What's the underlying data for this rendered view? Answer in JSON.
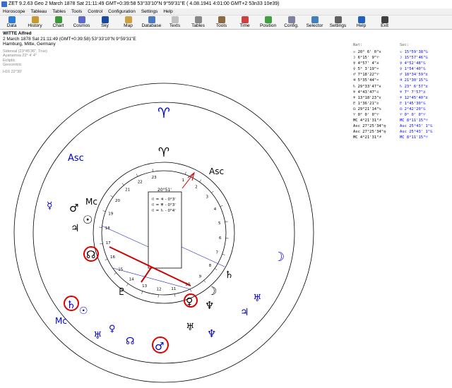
{
  "window": {
    "title": "ZET 9.2.63 Geo    2 March 1878  Sat  21:11:49 GMT+0:39:58 53°33'10\"N  9°59'31\"E  ( 4.08.1941   4:01:00 GMT+2 53n33 10e39)"
  },
  "menu": [
    "Horoscope",
    "Tableau",
    "Tables",
    "Tools",
    "Control",
    "Configuration",
    "Settings",
    "Help"
  ],
  "toolbar": [
    {
      "label": "Data",
      "color": "#2e7bd4"
    },
    {
      "label": "History",
      "color": "#c89a2e"
    },
    {
      "label": "Chart",
      "color": "#3a9a3a"
    },
    {
      "label": "Cosmos",
      "color": "#5a6acc"
    },
    {
      "label": "Sky",
      "color": "#1a4aa0"
    },
    {
      "label": "Map",
      "color": "#d0a040"
    },
    {
      "label": "Database",
      "color": "#4a7ac0"
    },
    {
      "label": "Texts",
      "color": "#c0c0c0"
    },
    {
      "label": "Tables",
      "color": "#888888"
    },
    {
      "label": "Tools",
      "color": "#8a6a40"
    },
    {
      "label": "Time",
      "color": "#d04040"
    },
    {
      "label": "Position",
      "color": "#40a040"
    },
    {
      "label": "Config.",
      "color": "#8080a0"
    },
    {
      "label": "Selector",
      "color": "#4080c0"
    },
    {
      "label": "Settings",
      "color": "#606060"
    },
    {
      "label": "Help",
      "color": "#2060c0"
    },
    {
      "label": "Exit",
      "color": "#404040"
    }
  ],
  "person": {
    "name": "WITTE Alfred",
    "line1": "2 March 1878  Sat  21:11:49 (GMT+0:39:58) 53°33'10\"N  9°59'31\"E",
    "line2": "Hamburg, Mitte, Germany",
    "settings": [
      "Sidereal (23°45'36\", True)",
      "Ayanamsa 22° 4' 4\"",
      "Ecliptic",
      "Geocentric"
    ],
    "harmonic": "H16  22°30'"
  },
  "table": {
    "header_natal": "Nat:",
    "header_secondary": "Sec:",
    "natal": [
      "☉  20° 6' 0\"♓",
      "☽   6°15' 9\"♈",
      "☿   4°57' 4\"♓",
      "♀   5° 3'19\"♒",
      "♂   7°18'22\"♈",
      "♃   5°35'44\"♒",
      "♄  29°33'47\"♓",
      "♅   4°43'47\"♌",
      "♆  13°18'23\"♉",
      "♇   1°36'21\"♉",
      "☊  29°21'14\"♑",
      "♈   0° 0' 0\"♈",
      "MC  4°21'31\"♐",
      "Asc 27°25'34\"♍",
      "Asc 27°25'34\"♍",
      "MC  4°21'31\"♐"
    ],
    "secondary": [
      "☉  15°59'38\"♋",
      "☽  15°57'46\"♋",
      "☿   4°52'48\"♋",
      "♀   1°54'40\"♋",
      "♂  18°34'59\"♊",
      "♃  21°30'15\"♋",
      "♄  23° 6'57\"♊",
      "♅   7° 7'57\"♊",
      "♆  12°45'40\"♊",
      "♇   1°45'30\"♋",
      "☊   2°42'20\"♋",
      "♈   0° 0' 0\"♈",
      "MC  8°11'15\"♈",
      "Asc 25°43' 1\"♋",
      "Asc 25°43' 1\"♋",
      "MC  8°11'15\"♈"
    ]
  },
  "chart": {
    "outer_labels": {
      "aries": "♈",
      "asc": "Asc",
      "mc": "Mc",
      "asc_inner": "Asc",
      "mc_inner": "Mc"
    },
    "box_title": "20°51'",
    "box_lines": [
      "♌ = ♃ - 0°3'",
      "♌ = ♅ - 0°3'",
      "♌ = ♄ - 0°4'"
    ],
    "degree_ticks": [
      "1",
      "2",
      "3",
      "4",
      "5",
      "6",
      "7",
      "8",
      "9",
      "10",
      "11",
      "12",
      "13",
      "14",
      "15",
      "16",
      "17",
      "18",
      "19",
      "20",
      "21",
      "22",
      "23"
    ],
    "outer_glyphs": [
      "☿",
      "♂",
      "☉",
      "♃",
      "☊",
      "♄",
      "☉",
      "♅",
      "♆",
      "♀",
      "♂",
      "☊",
      "♆",
      "♄",
      "☽",
      "♅",
      "♃",
      "♇",
      "♀",
      "♇",
      "☽",
      "♅"
    ]
  }
}
